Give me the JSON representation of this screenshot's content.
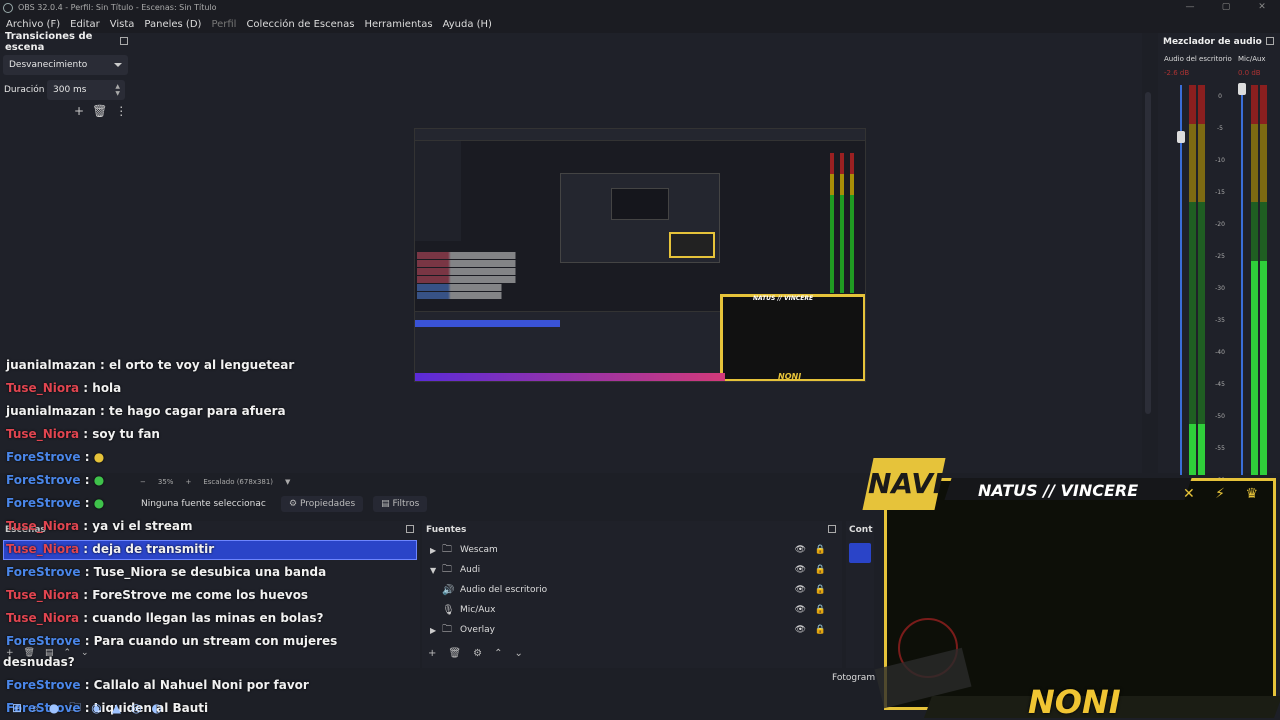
{
  "window": {
    "title": "OBS 32.0.4 - Perfil: Sin Título - Escenas: Sin Título",
    "controls": [
      "—",
      "▢",
      "✕"
    ]
  },
  "menu": {
    "items": [
      "Archivo (F)",
      "Editar",
      "Vista",
      "Paneles (D)",
      "Perfil",
      "Colección de Escenas",
      "Herramientas",
      "Ayuda (H)"
    ]
  },
  "transitions": {
    "title": "Transiciones de escena",
    "selected": "Desvanecimiento",
    "duration_label": "Duración",
    "duration_value": "300 ms"
  },
  "preview_status": {
    "zoom": "35%",
    "scaling": "Escalado (678x381)"
  },
  "context_bar": {
    "no_source": "Ninguna fuente seleccionac",
    "properties": "Propiedades",
    "filters": "Filtros"
  },
  "scenes": {
    "title": "Escenas"
  },
  "sources": {
    "title": "Fuentes",
    "items": [
      {
        "label": "Wescam",
        "arrow": "▶",
        "icon": "folder-icon"
      },
      {
        "label": "Audi",
        "arrow": "▼",
        "icon": "folder-icon"
      },
      {
        "label": "Audio del escritorio",
        "arrow": "",
        "icon": "speaker-icon"
      },
      {
        "label": "Mic/Aux",
        "arrow": "",
        "icon": "microphone-icon"
      },
      {
        "label": "Overlay",
        "arrow": "▶",
        "icon": "folder-icon"
      }
    ]
  },
  "controls": {
    "title": "Cont"
  },
  "mixer": {
    "title": "Mezclador de audio",
    "channels": [
      {
        "name": "Audio del escritorio",
        "db": "-2.6 dB",
        "level": 0.13
      },
      {
        "name": "Mic/Aux",
        "db": "0.0 dB",
        "level": 0.55
      }
    ],
    "scale": [
      "0",
      "-5",
      "-10",
      "-15",
      "-20",
      "-25",
      "-30",
      "-35",
      "-40",
      "-45",
      "-50",
      "-55",
      "-60"
    ]
  },
  "chat": [
    {
      "user": "juanialmazan",
      "message": ": el orto te voy al lenguetear",
      "color": "white"
    },
    {
      "user": "Tuse_Niora",
      "message": ": hola",
      "color": "red"
    },
    {
      "user": "juanialmazan",
      "message": ": te hago cagar para afuera",
      "color": "white"
    },
    {
      "user": "Tuse_Niora",
      "message": ": soy tu fan",
      "color": "red"
    },
    {
      "user": "ForeStrove",
      "message": ":",
      "color": "blue"
    },
    {
      "user": "ForeStrove",
      "message": ":",
      "color": "blue"
    },
    {
      "user": "ForeStrove",
      "message": ":",
      "color": "blue"
    },
    {
      "user": "Tuse_Niora",
      "message": ": ya vi el stream",
      "color": "red"
    },
    {
      "user": "Tuse_Niora",
      "message": ": deja de transmitir",
      "color": "red"
    },
    {
      "user": "ForeStrove",
      "message": ": Tuse_Niora se desubica una banda",
      "color": "blue"
    },
    {
      "user": "Tuse_Niora",
      "message": ": ForeStrove me come los huevos",
      "color": "red"
    },
    {
      "user": "Tuse_Niora",
      "message": ": cuando llegan las minas en bolas?",
      "color": "red"
    },
    {
      "user": "ForeStrove",
      "message": ": Para cuando un stream con mujeres",
      "color": "blue"
    },
    {
      "user": "",
      "message": "desnudas?",
      "color": "white"
    },
    {
      "user": "ForeStrove",
      "message": ": Callalo al Nahuel Noni por favor",
      "color": "blue"
    },
    {
      "user": "ForeStrove",
      "message": ": Liquiden al Bauti",
      "color": "blue"
    }
  ],
  "overlay": {
    "team": "NATUS // VINCERE",
    "logo": "NAVI",
    "player": "NONI"
  },
  "fotogram": "Fotogram",
  "colors": {
    "accent": "#2a44c8",
    "gold": "#e6c33a",
    "chat_red": "#e04550",
    "chat_blue": "#4a86e8"
  }
}
